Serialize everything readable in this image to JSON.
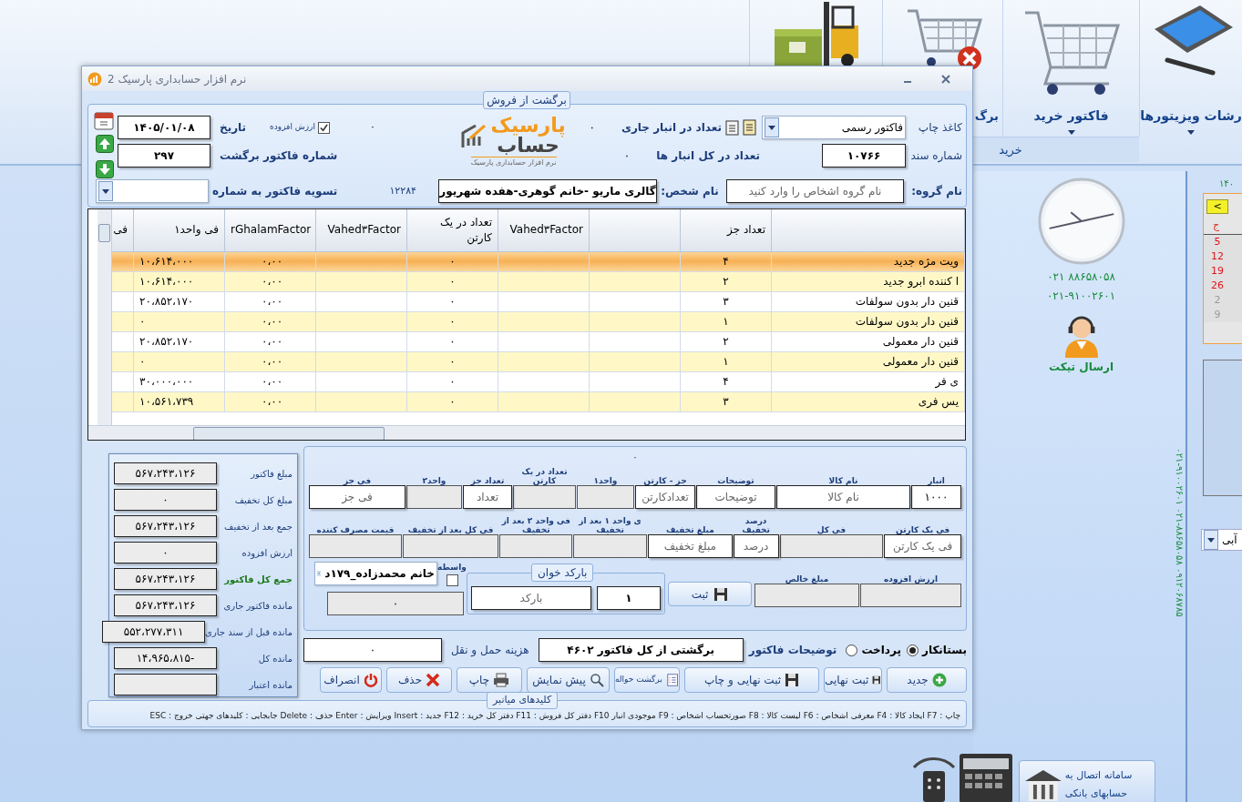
{
  "ribbon": {
    "tiles": [
      {
        "kind": "tablet",
        "label": "رشات ویزیتورها",
        "has_menu": true
      },
      {
        "kind": "cart",
        "label": "فاکتور خرید",
        "has_menu": true
      },
      {
        "kind": "cart-remove",
        "label": "برگ"
      },
      {
        "kind": "forklift"
      }
    ],
    "group_label": "خرید"
  },
  "window": {
    "title": "نرم افزار حسابداری پارسیک 2",
    "form_title": "برگشت از فروش"
  },
  "header": {
    "print_paper": {
      "label": "کاغذ چاپ",
      "value": "فاکتور رسمی"
    },
    "stock_current": {
      "label": "تعداد در انبار جاری",
      "value": "۰"
    },
    "document_number": {
      "label": "شماره سند",
      "value": "۱۰۷۶۶"
    },
    "stock_all": {
      "label": "تعداد در کل انبار ها",
      "value": "۰"
    },
    "logo": {
      "name": "پارسیک",
      "name_2": "حساب",
      "tagline": "نرم افزار حسابداری پارسیک"
    },
    "vat_value": "۰",
    "vat": {
      "label": "ارزش افزوده",
      "checked": true
    },
    "date": {
      "label": "تاریخ",
      "value": "۱۴۰۵/۰۱/۰۸"
    },
    "return_invoice_number": {
      "label": "شماره فاکتور برگشت",
      "value": "۲۹۷"
    },
    "group_name": {
      "label": "نام گروه:",
      "placeholder": "نام گروه اشخاص را وارد کنید"
    },
    "person_name": {
      "label": "نام شخص:",
      "value": "گالری ماریو -خانم گوهری-هفده شهریور"
    },
    "person_code": "۱۲۲۸۴",
    "settle_invoice": {
      "label": "تسویه فاکتور به شماره"
    }
  },
  "table": {
    "columns": [
      null,
      "تعداد جز",
      null,
      "Vahed۳Factor",
      "تعداد در یک کارتن",
      "Vahed۳Factor",
      "rGhalamFactor",
      "فی واحد۱",
      "فی"
    ],
    "rows": [
      {
        "selected": true,
        "cells": [
          "ویت مژه جدید",
          "۴",
          null,
          null,
          "۰",
          null,
          "۰،۰۰",
          "۱۰،۶۱۴،۰۰۰"
        ]
      },
      {
        "selected": false,
        "cells": [
          "ا کننده ابرو جدید",
          "۲",
          null,
          null,
          "۰",
          null,
          "۰،۰۰",
          "۱۰،۶۱۴،۰۰۰"
        ]
      },
      {
        "selected": false,
        "cells": [
          "قنین دار بدون سولفات",
          "۳",
          null,
          null,
          "۰",
          null,
          "۰،۰۰",
          "۲۰،۸۵۲،۱۷۰"
        ]
      },
      {
        "selected": false,
        "cells": [
          "قنین دار بدون سولفات",
          "۱",
          null,
          null,
          "۰",
          null,
          "۰،۰۰",
          "۰"
        ]
      },
      {
        "selected": false,
        "cells": [
          "قنین دار معمولی",
          "۲",
          null,
          null,
          "۰",
          null,
          "۰،۰۰",
          "۲۰،۸۵۲،۱۷۰"
        ]
      },
      {
        "selected": false,
        "cells": [
          "قنین دار معمولی",
          "۱",
          null,
          null,
          "۰",
          null,
          "۰،۰۰",
          "۰"
        ]
      },
      {
        "selected": false,
        "cells": [
          "ی فر",
          "۴",
          null,
          null,
          "۰",
          null,
          "۰،۰۰",
          "۳۰،۰۰۰،۰۰۰"
        ]
      },
      {
        "selected": false,
        "cells": [
          "یس فری",
          "۳",
          null,
          null,
          "۰",
          null,
          "۰،۰۰",
          "۱۰،۵۶۱،۷۳۹"
        ]
      }
    ]
  },
  "item_entry": {
    "top_value": "۰",
    "row_1": [
      {
        "label": "انبار",
        "value": "۱۰۰۰",
        "disabled": false
      },
      {
        "label": "نام کالا",
        "placeholder": "نام کالا",
        "disabled": false
      },
      {
        "label": "توضیحات",
        "placeholder": "توضیحات",
        "disabled": false
      },
      {
        "label": "جز - کارتن",
        "placeholder": "تعدادکارتن",
        "disabled": false
      },
      {
        "label": "واحد۱",
        "disabled": true
      },
      {
        "label": "تعداد در یک کارتن",
        "disabled": true
      },
      {
        "label": "تعداد جز",
        "placeholder": "تعداد",
        "disabled": false
      },
      {
        "label": "واحد۲",
        "disabled": true
      },
      {
        "label": "فی جز",
        "placeholder": "فی جز",
        "disabled": false
      }
    ],
    "row_2": [
      {
        "label": "فی یک کارتن",
        "placeholder": "فی یک کارتن",
        "disabled": false
      },
      {
        "label": "فی کل",
        "disabled": true
      },
      {
        "label": "درصد تخفیف",
        "placeholder": "درصد",
        "disabled": false
      },
      {
        "label": "مبلغ تخفیف",
        "placeholder": "مبلغ تخفیف",
        "disabled": false
      },
      {
        "label": "ی واحد ۱ بعد از تخفیف",
        "disabled": true
      },
      {
        "label": "فی واحد ۲ بعد از تخفیف",
        "disabled": true
      },
      {
        "label": "فی کل بعد از تخفیف",
        "disabled": true
      },
      {
        "label": "قیمت مصرف کننده",
        "disabled": true
      }
    ],
    "row_3": [
      {
        "label": "ارزش افزوده",
        "disabled": true
      },
      {
        "label": "مبلغ خالص",
        "disabled": true
      }
    ],
    "register_button": "ثبت",
    "barcode": {
      "title": "بارکد خوان",
      "quantity": "۱",
      "placeholder": "بارکد"
    },
    "intermediary": {
      "label": "واسطه",
      "checked": false,
      "value": "خانم محمدزاده_۱۷۹د",
      "amount": "۰"
    }
  },
  "payment": {
    "options": [
      {
        "label": "بستانکار",
        "selected": true
      },
      {
        "label": "پرداخت",
        "selected": false
      }
    ],
    "notes": {
      "label": "توضیحات فاکتور",
      "value": "برگشتی از کل فاکتور ۴۶۰۲"
    },
    "shipping": {
      "label": "هزینه حمل و نقل",
      "value": "۰"
    }
  },
  "buttons": [
    {
      "kind": "new",
      "label": "جدید"
    },
    {
      "kind": "save",
      "label": "ثبت نهایی"
    },
    {
      "kind": "save",
      "label": "ثبت نهایی و چاپ"
    },
    {
      "kind": "list",
      "label": "برگشت حواله"
    },
    {
      "kind": "preview",
      "label": "پیش نمایش"
    },
    {
      "kind": "print",
      "label": "چاپ"
    },
    {
      "kind": "delete",
      "label": "حذف"
    },
    {
      "kind": "cancel",
      "label": "انصراف"
    }
  ],
  "summary": [
    {
      "label": "مبلغ فاکتور",
      "value": "۵۶۷،۲۴۳،۱۲۶",
      "highlight": false
    },
    {
      "label": "مبلغ کل تخفیف",
      "value": "۰",
      "highlight": false
    },
    {
      "label": "جمع بعد از تخفیف",
      "value": "۵۶۷،۲۴۳،۱۲۶",
      "highlight": false
    },
    {
      "label": "ارزش افزوده",
      "value": "۰",
      "highlight": false
    },
    {
      "label": "جمع کل فاکتور",
      "value": "۵۶۷،۲۴۳،۱۲۶",
      "highlight": true
    },
    {
      "label": "مانده فاکتور جاری",
      "value": "۵۶۷،۲۴۳،۱۲۶",
      "highlight": false
    },
    {
      "label": "مانده قبل از سند جاری",
      "value": "۵۵۲،۲۷۷،۳۱۱",
      "highlight": false
    },
    {
      "label": "مانده کل",
      "value": "-۱۴،۹۶۵،۸۱۵",
      "highlight": false
    },
    {
      "label": "مانده اعتبار",
      "highlight": false
    }
  ],
  "shortcuts": {
    "title": "کلیدهای میانبر",
    "text": "چاپ : F7  ایجاد کالا : F4  معرفی اشخاص : F6  لیست کالا : F8  صورتحساب اشخاص : F9  موجودی انبار F10  دفتر کل فروش : F11  دفتر کل خرید : F12  جدید : Insert  ویرایش : Enter  حذف : Delete  جابجایی : کلیدهای جهتی  خروج : ESC"
  },
  "support": {
    "phones": [
      "۰۲۱ ۸۸۶۵۸۰۵۸",
      "۰۲۱-۹۱۰۰۲۶۰۱"
    ],
    "ticket": "ارسال تیکت",
    "vertical_text": "۰۲۱-۹۱۰۰۲۶۰۱  ۰۲۱-۸۸۶۵۸۰۵۸  ۰۹۱۲۰۶۸۷۸۵"
  },
  "calendar": {
    "year": "۱۴۰",
    "nav": "<",
    "weekday": "ج",
    "days": [
      {
        "label": "5",
        "kind": "holiday"
      },
      {
        "label": "12",
        "kind": "holiday"
      },
      {
        "label": "19",
        "kind": "holiday"
      },
      {
        "label": "26",
        "kind": "holiday"
      },
      {
        "label": "2",
        "kind": "other"
      },
      {
        "label": "9",
        "kind": "other"
      }
    ]
  },
  "theme_select": {
    "value": "آبی"
  },
  "bank_tile": {
    "label": "سامانه اتصال به حسابهای بانکی"
  }
}
